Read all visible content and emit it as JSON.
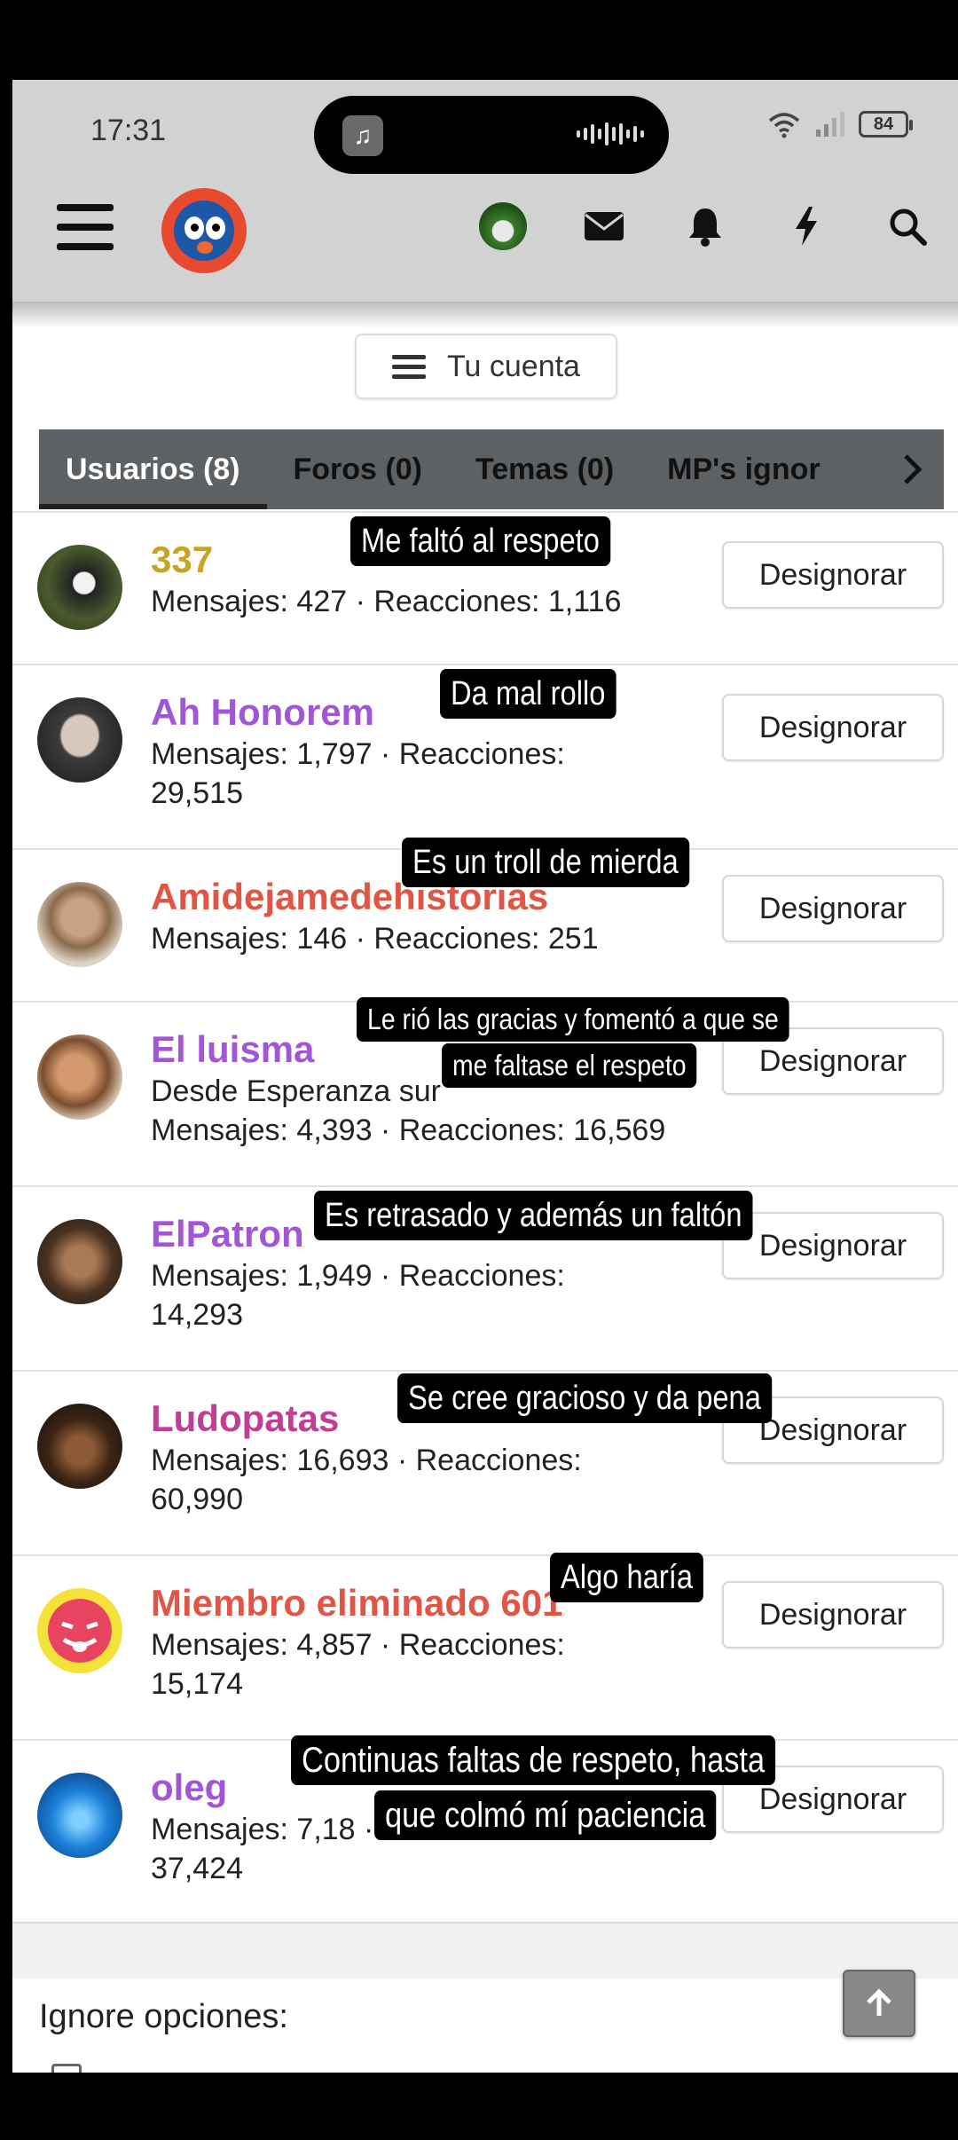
{
  "status_bar": {
    "time": "17:31",
    "battery": "84"
  },
  "colors": {
    "tab_bg": "#5d6164",
    "gold": "#c9a227",
    "purple": "#a056d6",
    "coral": "#e05544",
    "magenta": "#c23e94",
    "blue": "#3b82d6"
  },
  "header": {
    "icons": [
      "menu-icon",
      "site-logo",
      "user-avatar",
      "envelope-icon",
      "bell-icon",
      "lightning-icon",
      "search-icon"
    ]
  },
  "account_button": {
    "label": "Tu cuenta"
  },
  "tabs": [
    {
      "label": "Usuarios (8)"
    },
    {
      "label": "Foros (0)"
    },
    {
      "label": "Temas (0)"
    },
    {
      "label": "MP's ignor"
    }
  ],
  "users": [
    {
      "name": "337",
      "stats": "Mensajes: 427 · Reacciones: 1,116",
      "button": "Designorar",
      "note": "Me faltó al respeto"
    },
    {
      "name": "Ah Honorem",
      "stats": "Mensajes: 1,797 · Reacciones: 29,515",
      "button": "Designorar",
      "note": "Da mal rollo"
    },
    {
      "name": "Amidejamedehistorias",
      "stats": "Mensajes: 146 · Reacciones: 251",
      "button": "Designorar",
      "note": "Es un troll de mierda"
    },
    {
      "name": "El luisma",
      "subtitle": "Desde Esperanza sur",
      "stats": "Mensajes: 4,393 · Reacciones: 16,569",
      "button": "Designorar",
      "note_line1": "Le rió las gracias y fomentó a que se",
      "note_line2": "me faltase el respeto"
    },
    {
      "name": "ElPatron",
      "stats": "Mensajes: 1,949 · Reacciones: 14,293",
      "button": "Designorar",
      "note": "Es retrasado y además un faltón"
    },
    {
      "name": "Ludopatas",
      "stats": "Mensajes: 16,693 · Reacciones: 60,990",
      "button": "Designorar",
      "note": "Se cree gracioso y da pena"
    },
    {
      "name": "Miembro eliminado 601",
      "stats": "Mensajes: 4,857 · Reacciones: 15,174",
      "button": "Designorar",
      "note": "Algo haría"
    },
    {
      "name": "oleg",
      "stats": "Mensajes: 7,18 · Reacciones: 37,424",
      "button": "Designorar",
      "note_line1": "Continuas faltas de respeto, hasta",
      "note_line2": "que colmó mí paciencia"
    }
  ],
  "footer": {
    "ignore_options": "Ignore opciones:"
  }
}
